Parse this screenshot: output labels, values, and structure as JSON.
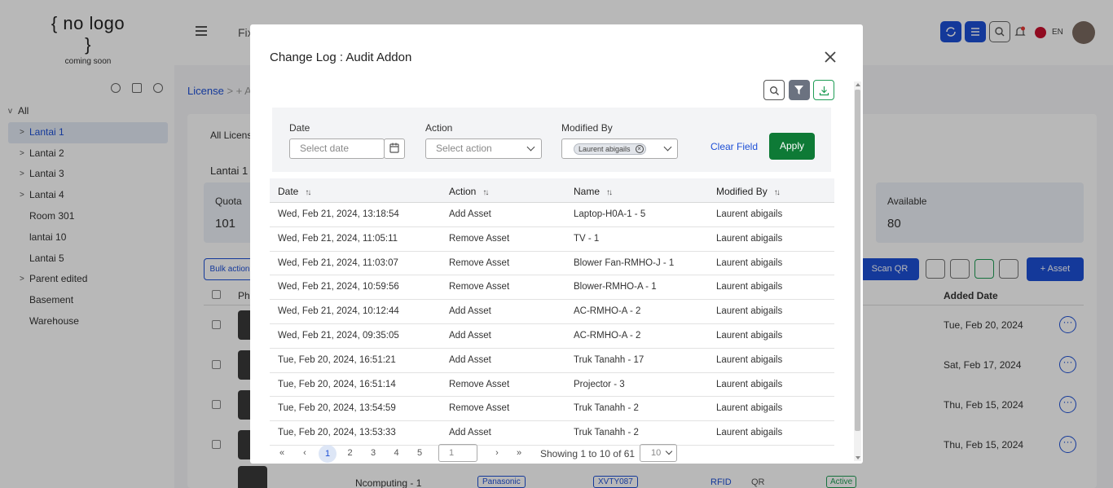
{
  "app": {
    "logo_main": "{ no logo }",
    "logo_sub": "coming soon",
    "top_partial": "Fix",
    "lang": "EN"
  },
  "sidebar": {
    "items": [
      {
        "label": "All",
        "expander": "v"
      },
      {
        "label": "Lantai 1",
        "expander": ">"
      },
      {
        "label": "Lantai 2",
        "expander": ">"
      },
      {
        "label": "Lantai 3",
        "expander": ">"
      },
      {
        "label": "Lantai 4",
        "expander": ">"
      },
      {
        "label": "Room 301",
        "expander": ""
      },
      {
        "label": "lantai 10",
        "expander": ""
      },
      {
        "label": "Lantai 5",
        "expander": ""
      },
      {
        "label": "Parent edited",
        "expander": ">"
      },
      {
        "label": "Basement",
        "expander": ""
      },
      {
        "label": "Warehouse",
        "expander": ""
      }
    ]
  },
  "background": {
    "breadcrumb_root": "License",
    "breadcrumb_sep": ">",
    "breadcrumb_next": "+ A",
    "tab_label": "All Licens",
    "section_title": "Lantai 1",
    "quota_label": "Quota",
    "quota_value": "101",
    "available_label": "Available",
    "available_value": "80",
    "bulk_action": "Bulk action",
    "scan_qr": "Scan QR",
    "add_asset": "Asset",
    "col_photo": "Pho",
    "col_added": "Added Date",
    "rows": [
      {
        "date": "Tue, Feb 20, 2024"
      },
      {
        "date": "Sat, Feb 17, 2024"
      },
      {
        "date": "Thu, Feb 15, 2024"
      },
      {
        "date": "Thu, Feb 15, 2024"
      }
    ],
    "last_row": {
      "name": "Ncomputing - 1",
      "brand": "Panasonic",
      "serial": "XVTY087",
      "rfid": "RFID",
      "qr": "QR",
      "status": "Active"
    }
  },
  "modal": {
    "title": "Change Log : Audit Addon",
    "filters": {
      "date_label": "Date",
      "date_placeholder": "Select date",
      "action_label": "Action",
      "action_placeholder": "Select action",
      "modified_label": "Modified By",
      "modified_chip": "Laurent abigails",
      "clear_label": "Clear Field",
      "apply_label": "Apply"
    },
    "columns": [
      "Date",
      "Action",
      "Name",
      "Modified By"
    ],
    "rows": [
      {
        "date": "Wed, Feb 21, 2024, 13:18:54",
        "action": "Add Asset",
        "name": "Laptop-H0A-1 - 5",
        "by": "Laurent abigails"
      },
      {
        "date": "Wed, Feb 21, 2024, 11:05:11",
        "action": "Remove Asset",
        "name": "TV - 1",
        "by": "Laurent abigails"
      },
      {
        "date": "Wed, Feb 21, 2024, 11:03:07",
        "action": "Remove Asset",
        "name": "Blower Fan-RMHO-J - 1",
        "by": "Laurent abigails"
      },
      {
        "date": "Wed, Feb 21, 2024, 10:59:56",
        "action": "Remove Asset",
        "name": "Blower-RMHO-A - 1",
        "by": "Laurent abigails"
      },
      {
        "date": "Wed, Feb 21, 2024, 10:12:44",
        "action": "Add Asset",
        "name": "AC-RMHO-A - 2",
        "by": "Laurent abigails"
      },
      {
        "date": "Wed, Feb 21, 2024, 09:35:05",
        "action": "Add Asset",
        "name": "AC-RMHO-A - 2",
        "by": "Laurent abigails"
      },
      {
        "date": "Tue, Feb 20, 2024, 16:51:21",
        "action": "Add Asset",
        "name": "Truk Tanahh - 17",
        "by": "Laurent abigails"
      },
      {
        "date": "Tue, Feb 20, 2024, 16:51:14",
        "action": "Remove Asset",
        "name": "Projector - 3",
        "by": "Laurent abigails"
      },
      {
        "date": "Tue, Feb 20, 2024, 13:54:59",
        "action": "Remove Asset",
        "name": "Truk Tanahh - 2",
        "by": "Laurent abigails"
      },
      {
        "date": "Tue, Feb 20, 2024, 13:53:33",
        "action": "Add Asset",
        "name": "Truk Tanahh - 2",
        "by": "Laurent abigails"
      }
    ],
    "pagination": {
      "first": "«",
      "prev": "‹",
      "pages": [
        "1",
        "2",
        "3",
        "4",
        "5"
      ],
      "current": "1",
      "next": "›",
      "last": "»",
      "goto_value": "1",
      "info": "Showing 1 to 10 of 61",
      "page_size": "10"
    }
  },
  "colors": {
    "primary": "#1d4fd6",
    "apply": "#0e7a36",
    "download": "#1f9d55",
    "filter_active": "#6b7280"
  }
}
